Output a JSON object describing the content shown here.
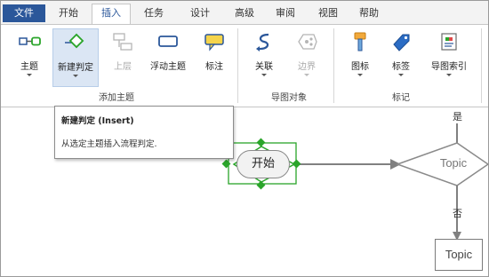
{
  "menu": {
    "file": "文件",
    "tabs": [
      "开始",
      "插入",
      "任务",
      "设计",
      "高级",
      "审阅",
      "视图",
      "帮助"
    ],
    "active_tab": "插入"
  },
  "ribbon": {
    "groups": [
      {
        "label": "添加主题",
        "buttons": [
          {
            "label": "主题",
            "icon": "topic-icon",
            "disabled": false
          },
          {
            "label": "新建判定",
            "icon": "decision-icon",
            "disabled": false,
            "highlighted": true
          },
          {
            "label": "上层",
            "icon": "parent-topic-icon",
            "disabled": true
          },
          {
            "label": "浮动主题",
            "icon": "floating-topic-icon",
            "disabled": false
          },
          {
            "label": "标注",
            "icon": "callout-icon",
            "disabled": false
          }
        ]
      },
      {
        "label": "导图对象",
        "buttons": [
          {
            "label": "关联",
            "icon": "relationship-icon",
            "disabled": false
          },
          {
            "label": "边界",
            "icon": "boundary-icon",
            "disabled": true
          }
        ]
      },
      {
        "label": "标记",
        "buttons": [
          {
            "label": "图标",
            "icon": "marker-icon",
            "disabled": false
          },
          {
            "label": "标签",
            "icon": "tag-icon",
            "disabled": false
          },
          {
            "label": "导图索引",
            "icon": "map-index-icon",
            "disabled": false
          }
        ]
      }
    ]
  },
  "tooltip": {
    "title": "新建判定 (Insert)",
    "description": "从选定主题插入流程判定."
  },
  "diagram": {
    "start_label": "开始",
    "decision_label": "Topic",
    "yes_label": "是",
    "no_label": "否",
    "topic_label": "Topic"
  },
  "colors": {
    "accent": "#2b579a",
    "selection": "#2aa52a",
    "connector": "#808080"
  }
}
